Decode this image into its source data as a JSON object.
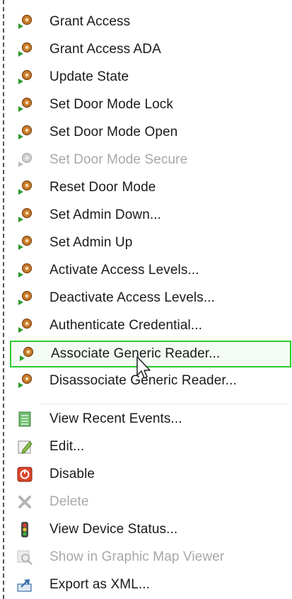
{
  "menu": {
    "items": [
      {
        "label": "Grant Access",
        "icon": "door-command-icon",
        "enabled": true
      },
      {
        "label": "Grant Access ADA",
        "icon": "door-command-icon",
        "enabled": true
      },
      {
        "label": "Update State",
        "icon": "door-command-icon",
        "enabled": true
      },
      {
        "label": "Set Door Mode Lock",
        "icon": "door-command-icon",
        "enabled": true
      },
      {
        "label": "Set Door Mode Open",
        "icon": "door-command-icon",
        "enabled": true
      },
      {
        "label": "Set Door Mode Secure",
        "icon": "door-command-icon",
        "enabled": false
      },
      {
        "label": "Reset Door Mode",
        "icon": "door-command-icon",
        "enabled": true
      },
      {
        "label": "Set Admin Down...",
        "icon": "door-command-icon",
        "enabled": true
      },
      {
        "label": "Set Admin Up",
        "icon": "door-command-icon",
        "enabled": true
      },
      {
        "label": "Activate Access Levels...",
        "icon": "door-command-icon",
        "enabled": true
      },
      {
        "label": "Deactivate Access Levels...",
        "icon": "door-command-icon",
        "enabled": true
      },
      {
        "label": "Authenticate Credential...",
        "icon": "door-command-icon",
        "enabled": true
      },
      {
        "label": "Associate Generic Reader...",
        "icon": "door-command-icon",
        "enabled": true,
        "highlighted": true
      },
      {
        "label": "Disassociate Generic Reader...",
        "icon": "door-command-icon",
        "enabled": true
      },
      {
        "label": "View Recent Events...",
        "icon": "event-list-icon",
        "enabled": true
      },
      {
        "label": "Edit...",
        "icon": "edit-icon",
        "enabled": true
      },
      {
        "label": "Disable",
        "icon": "disable-icon",
        "enabled": true
      },
      {
        "label": "Delete",
        "icon": "delete-icon",
        "enabled": false
      },
      {
        "label": "View Device Status...",
        "icon": "traffic-light-icon",
        "enabled": true
      },
      {
        "label": "Show in Graphic Map Viewer",
        "icon": "map-search-icon",
        "enabled": false
      },
      {
        "label": "Export as XML...",
        "icon": "export-icon",
        "enabled": true
      }
    ]
  },
  "colors": {
    "highlight_border": "#2ecc2e",
    "disabled_text": "#a8a8a8",
    "text": "#1a1a1a"
  }
}
